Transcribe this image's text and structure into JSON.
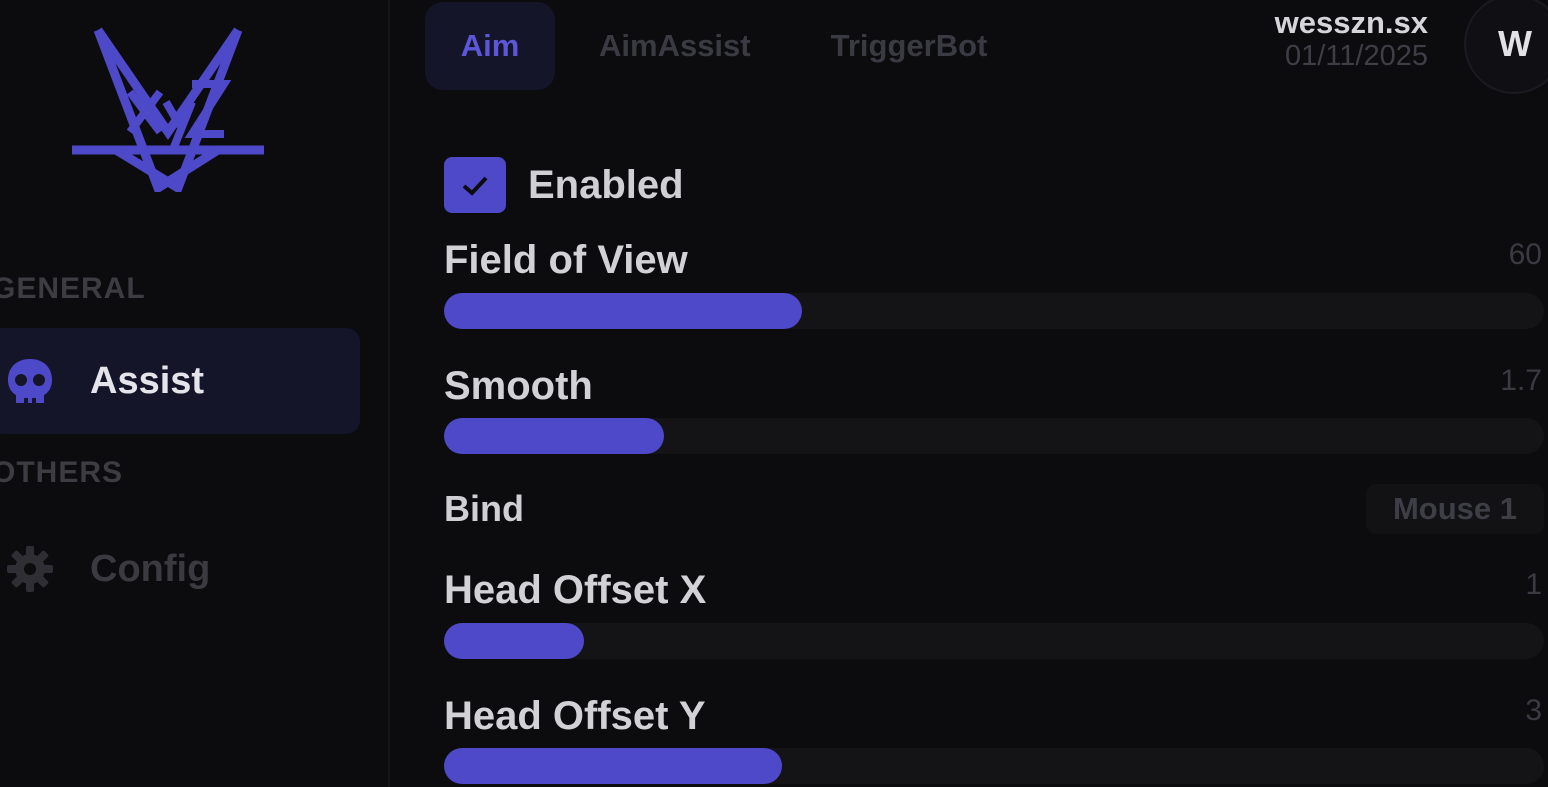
{
  "sidebar": {
    "sections": [
      {
        "label": "GENERAL"
      },
      {
        "label": "OTHERS"
      }
    ],
    "items": [
      {
        "label": "Assist",
        "icon": "skull-icon",
        "active": true
      },
      {
        "label": "Config",
        "icon": "gear-icon",
        "active": false
      }
    ]
  },
  "tabs": [
    {
      "label": "Aim",
      "active": true
    },
    {
      "label": "AimAssist",
      "active": false
    },
    {
      "label": "TriggerBot",
      "active": false
    }
  ],
  "user": {
    "name": "wesszn.sx",
    "date": "01/11/2025",
    "avatar_initial": "W"
  },
  "settings": {
    "enabled": {
      "label": "Enabled",
      "checked": true
    },
    "fov": {
      "label": "Field of View",
      "value": "60",
      "fill_fraction": 0.325
    },
    "smooth": {
      "label": "Smooth",
      "value": "1.7",
      "fill_fraction": 0.2
    },
    "bind": {
      "label": "Bind",
      "value": "Mouse 1"
    },
    "head_offset_x": {
      "label": "Head Offset X",
      "value": "1",
      "fill_fraction": 0.127
    },
    "head_offset_y": {
      "label": "Head Offset Y",
      "value": "3",
      "fill_fraction": 0.307
    }
  },
  "colors": {
    "accent": "#4d49c8",
    "background": "#0c0c0e",
    "active_bg": "#15152a"
  }
}
